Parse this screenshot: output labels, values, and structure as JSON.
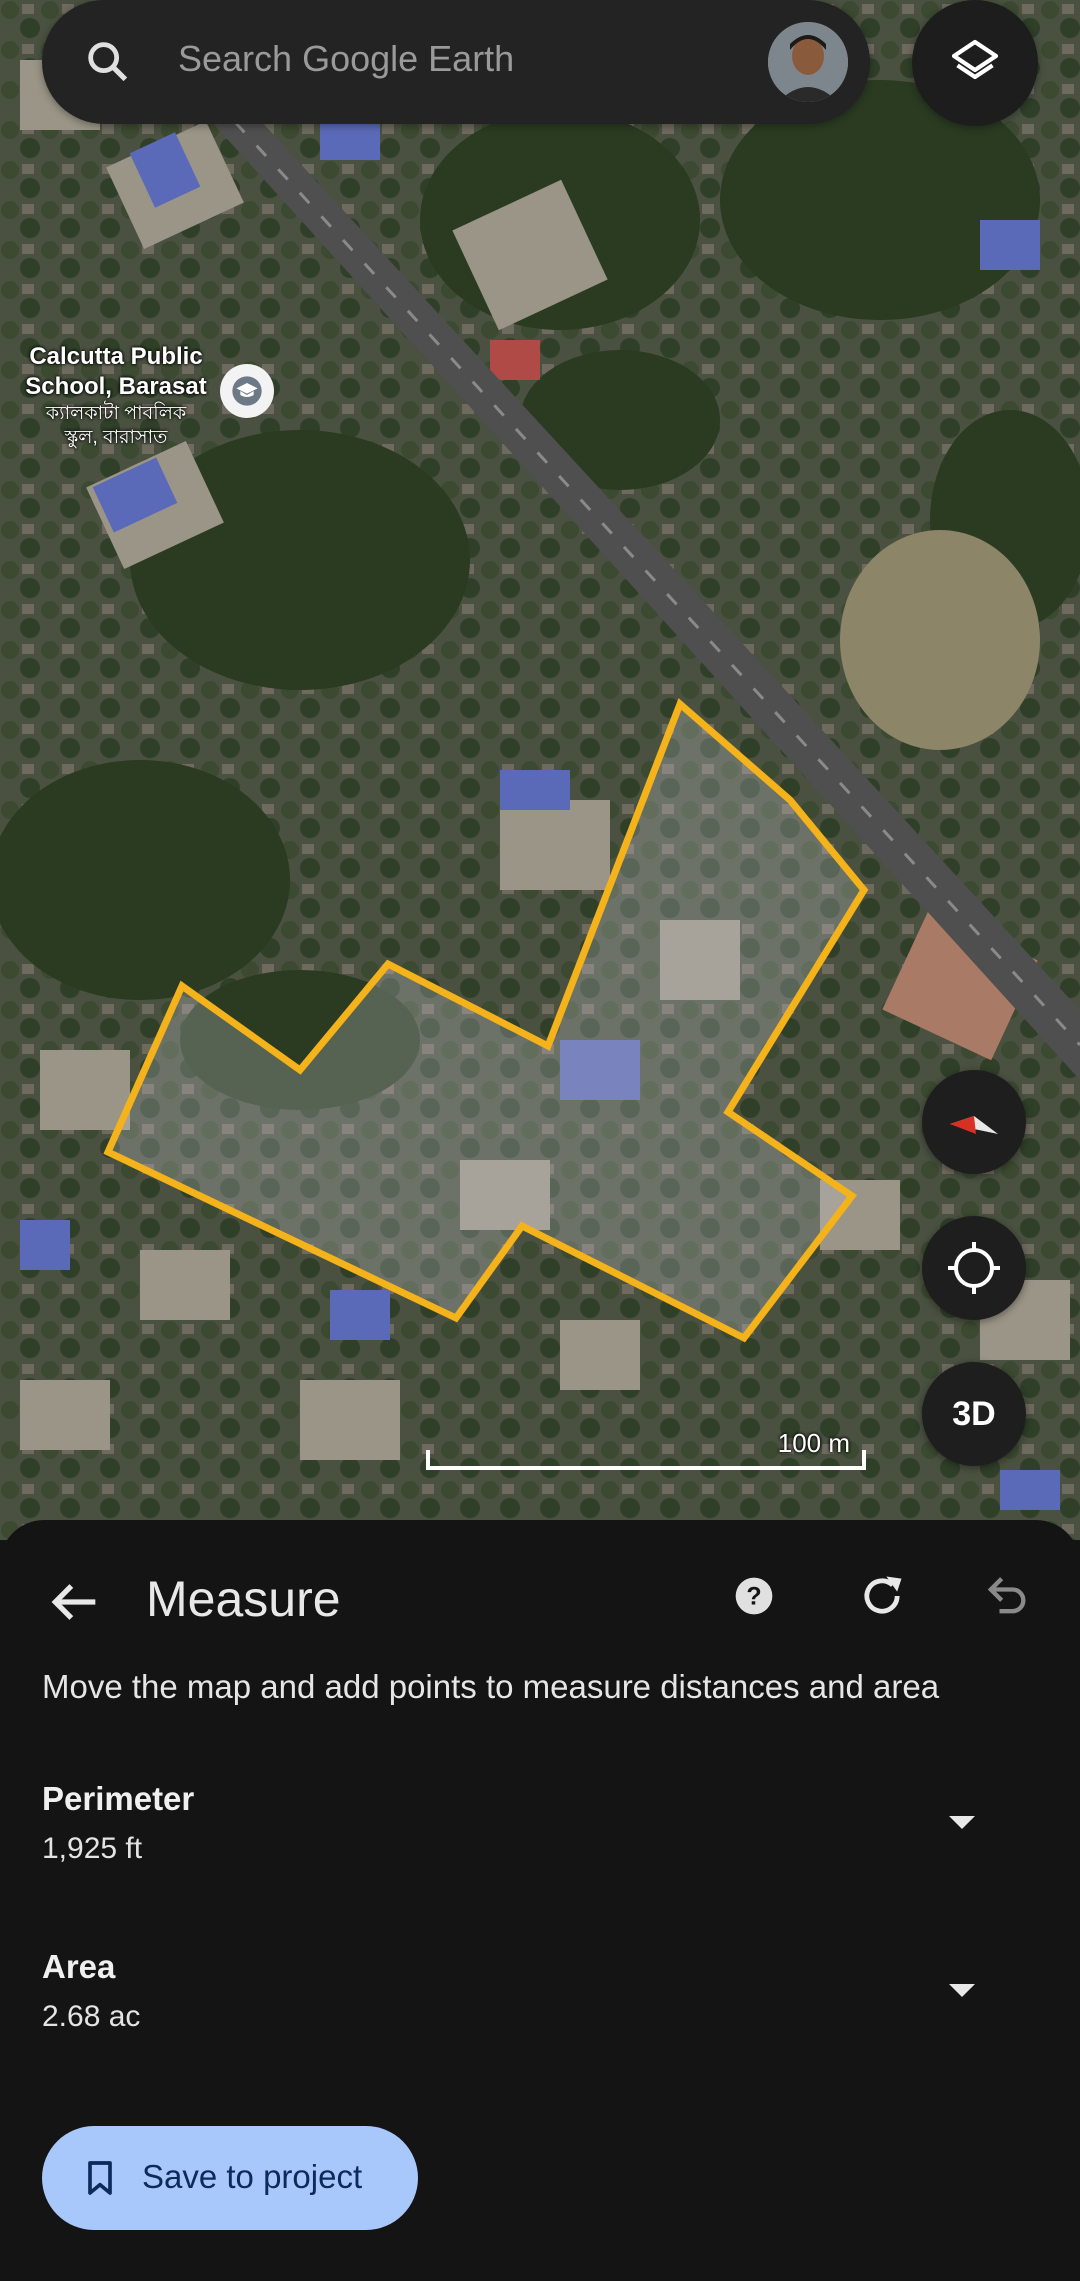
{
  "search": {
    "placeholder": "Search Google Earth"
  },
  "map": {
    "poi_name_en_line1": "Calcutta Public",
    "poi_name_en_line2": "School, Barasat",
    "poi_name_bn_line1": "ক্যালকাটা পাবলিক",
    "poi_name_bn_line2": "স্কুল, বারাসাত",
    "scale_label": "100 m",
    "measure_outline_color": "#f4b21b",
    "three_d_label": "3D"
  },
  "measure": {
    "title": "Measure",
    "instructions": "Move the map and add points to measure distances and area",
    "perimeter_label": "Perimeter",
    "perimeter_value": "1,925 ft",
    "area_label": "Area",
    "area_value": "2.68 ac",
    "save_label": "Save to project"
  },
  "colors": {
    "sheet_bg": "#141414",
    "save_button_bg": "#a8c7fa",
    "save_button_text": "#0d2a5a"
  },
  "icons": [
    "search-icon",
    "layers-icon",
    "school-icon",
    "compass-icon",
    "my-location-icon",
    "back-arrow-icon",
    "help-icon",
    "reset-icon",
    "undo-icon",
    "chevron-down-icon",
    "bookmark-icon"
  ]
}
